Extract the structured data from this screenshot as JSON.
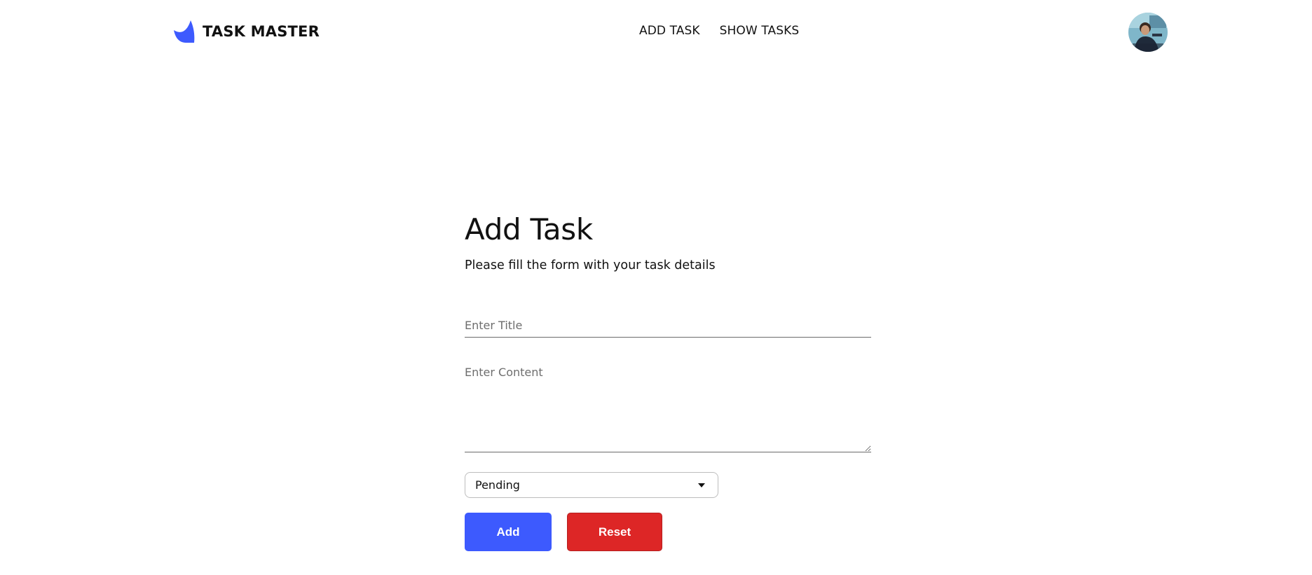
{
  "header": {
    "brand_name": "TASK MASTER",
    "brand_color": "#3d5afe",
    "logo_icon": "sail-logo-icon",
    "nav": [
      {
        "label": "ADD TASK"
      },
      {
        "label": "SHOW TASKS"
      }
    ],
    "avatar_icon": "user-avatar"
  },
  "form": {
    "title": "Add Task",
    "subtitle": "Please fill the form with your task details",
    "title_placeholder": "Enter Title",
    "title_value": "",
    "content_placeholder": "Enter Content",
    "content_value": "",
    "status_selected": "Pending",
    "add_label": "Add",
    "reset_label": "Reset",
    "add_color": "#3d5afe",
    "reset_color": "#dd2626"
  }
}
